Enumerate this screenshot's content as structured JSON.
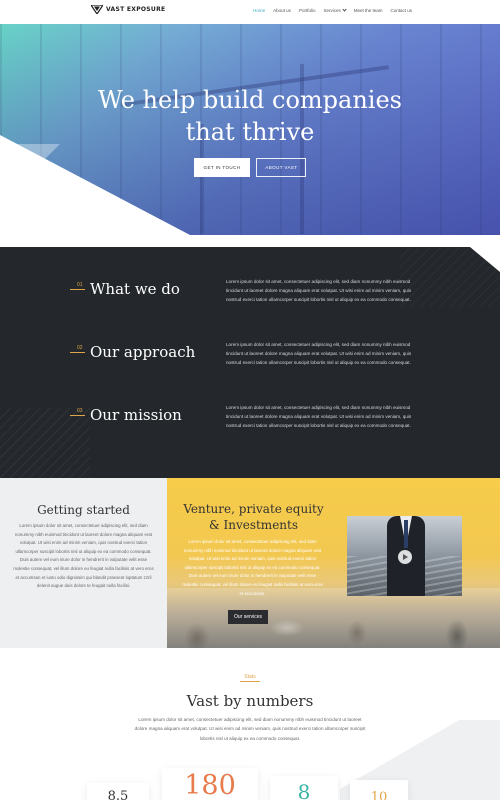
{
  "nav": {
    "logo_text": "VAST EXPOSURE",
    "items": [
      {
        "label": "Home"
      },
      {
        "label": "About us"
      },
      {
        "label": "Portfolio"
      },
      {
        "label": "Services"
      },
      {
        "label": "Meet the team"
      },
      {
        "label": "Contact us"
      }
    ],
    "active_color": "#3fa9c4"
  },
  "hero": {
    "title_line1": "We help build companies",
    "title_line2": "that thrive",
    "button_primary": "GET IN TOUCH",
    "button_secondary": "ABOUT VAST"
  },
  "features": [
    {
      "num": "01",
      "heading": "What we do",
      "text": "Lorem ipsum dolor sit amet, consectetuer adipiscing elit, sed diam nonummy nibh euismod tincidunt ut laoreet dolore magna aliquam erat volutpat. Ut wisi enim ad minim veniam, quis nostrud exerci tation ullamcorper suscipit lobortis nisl ut aliquip ex ea commodo consequat."
    },
    {
      "num": "02",
      "heading": "Our approach",
      "text": "Lorem ipsum dolor sit amet, consectetuer adipiscing elit, sed diam nonummy nibh euismod tincidunt ut laoreet dolore magna aliquam erat volutpat. Ut wisi enim ad minim veniam, quis nostrud exerci tation ullamcorper suscipit lobortis nisl ut aliquip ex ea commodo consequat."
    },
    {
      "num": "03",
      "heading": "Our mission",
      "text": "Lorem ipsum dolor sit amet, consectetuer adipiscing elit, sed diam nonummy nibh euismod tincidunt ut laoreet dolore magna aliquam erat volutpat. Ut wisi enim ad minim veniam, quis nostrud exerci tation ullamcorper suscipit lobortis nisl ut aliquip ex ea commodo consequat."
    }
  ],
  "getting_started": {
    "title": "Getting started",
    "text": "Lorem ipsum dolor sit amet, consectetuer adipiscing elit, sed diam nonummy nibh euismod tincidunt ut laoreet dolore magna aliquam erat volutpat. Ut wisi enim ad minim veniam, quis nostrud exerci tation ullamcorper suscipit lobortis nisl ut aliquip ex ea commodo consequat. Duis autem vel eum iriure dolor in hendrerit in vulputate velit esse molestie consequat, vel illum dolore eu feugiat nulla facilisis at vero eros et accumsan et iusto odio dignissim qui blandit praesent luptatum zzril delenit augue duis dolore te feugait nulla facilisi."
  },
  "venture": {
    "title_line1": "Venture, private equity",
    "title_line2": "& Investments",
    "text": "Lorem ipsum dolor sit amet, consectetuer adipiscing elit, sed diam nonummy nibh euismod tincidunt ut laoreet dolore magna aliquam erat volutpat. Ut wisi enim ad minim veniam, quis nostrud exerci tation ullamcorper suscipit lobortis nisl ut aliquip ex ea commodo consequat. Duis autem vel eum iriure dolor in hendrerit in vulputate velit esse molestie consequat, vel illum dolore eu feugiat nulla facilisis at vero eros et accumsan.",
    "button": "Our services"
  },
  "stats": {
    "eyebrow": "Stats",
    "title": "Vast by numbers",
    "text": "Lorem ipsum dolor sit amet, consectetuer adipiscing elit, sed diam nonummy nibh euismod tincidunt ut laoreet dolore magna aliquam erat volutpat. Ut wisi enim ad minim veniam, quis nostrud exerci tation ullamcorper suscipit lobortis nisl ut aliquip ex ea commodo consequat.",
    "values": [
      "8.5",
      "180",
      "8",
      "10"
    ],
    "colors": [
      "#333333",
      "#e77b4b",
      "#3ab5a2",
      "#e0a54a"
    ]
  }
}
